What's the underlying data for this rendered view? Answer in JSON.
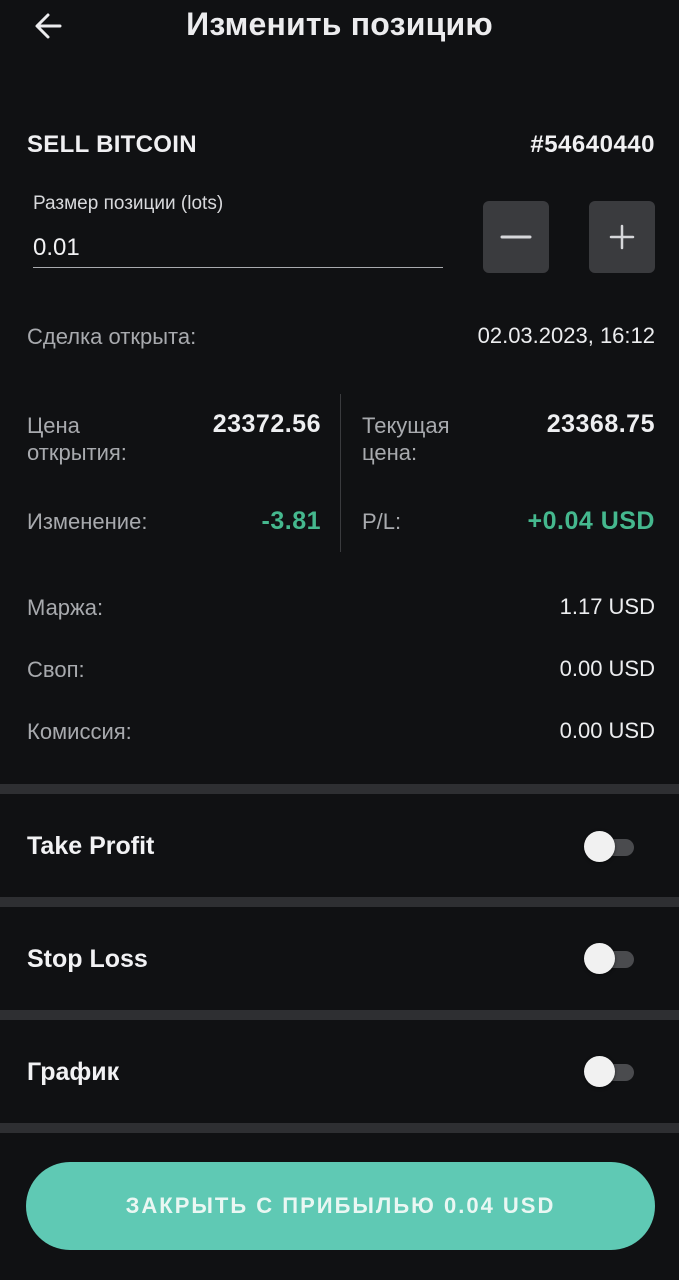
{
  "header": {
    "title": "Изменить позицию",
    "back_icon": "arrow-left-icon"
  },
  "position": {
    "symbol": "SELL BITCOIN",
    "ticket": "#54640440",
    "size_label": "Размер позиции (lots)",
    "size_value": "0.01",
    "minus_icon": "minus-icon",
    "plus_icon": "plus-icon"
  },
  "details": {
    "opened_label": "Сделка открыта:",
    "opened_value": "02.03.2023, 16:12",
    "open_price_label_1": "Цена",
    "open_price_label_2": "открытия:",
    "open_price_value": "23372.56",
    "current_price_label_1": "Текущая",
    "current_price_label_2": "цена:",
    "current_price_value": "23368.75",
    "change_label": "Изменение:",
    "change_value": "-3.81",
    "pl_label": "P/L:",
    "pl_value": "+0.04 USD",
    "margin_label": "Маржа:",
    "margin_value": "1.17 USD",
    "swap_label": "Своп:",
    "swap_value": "0.00 USD",
    "commission_label": "Комиссия:",
    "commission_value": "0.00 USD"
  },
  "toggles": {
    "take_profit_label": "Take Profit",
    "take_profit_on": false,
    "stop_loss_label": "Stop Loss",
    "stop_loss_on": false,
    "chart_label": "График",
    "chart_on": false
  },
  "action": {
    "close_label": "ЗАКРЫТЬ С ПРИБЫЛЬЮ 0.04 USD"
  },
  "colors": {
    "background": "#101113",
    "positive": "#45b88e",
    "button": "#5fc9b4"
  }
}
